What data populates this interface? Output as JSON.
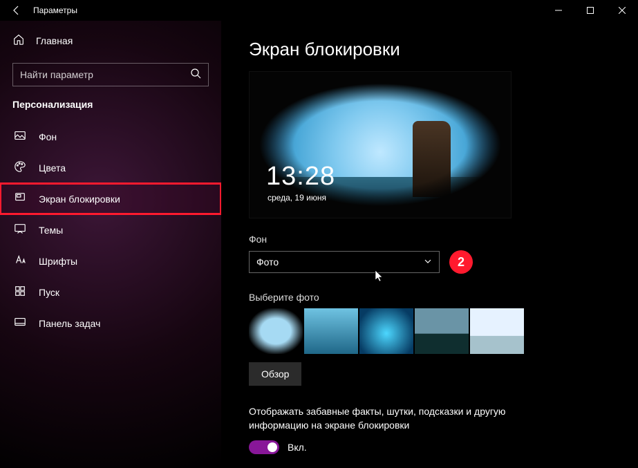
{
  "window": {
    "title": "Параметры"
  },
  "sidebar": {
    "home": "Главная",
    "search_placeholder": "Найти параметр",
    "section": "Персонализация",
    "items": [
      {
        "label": "Фон"
      },
      {
        "label": "Цвета"
      },
      {
        "label": "Экран блокировки"
      },
      {
        "label": "Темы"
      },
      {
        "label": "Шрифты"
      },
      {
        "label": "Пуск"
      },
      {
        "label": "Панель задач"
      }
    ]
  },
  "main": {
    "heading": "Экран блокировки",
    "preview": {
      "time": "13:28",
      "date": "среда, 19 июня"
    },
    "bg_label": "Фон",
    "bg_value": "Фото",
    "badge": "2",
    "choose_label": "Выберите фото",
    "browse": "Обзор",
    "tip": "Отображать забавные факты, шутки, подсказки и другую информацию на экране блокировки",
    "toggle_on": "Вкл."
  }
}
